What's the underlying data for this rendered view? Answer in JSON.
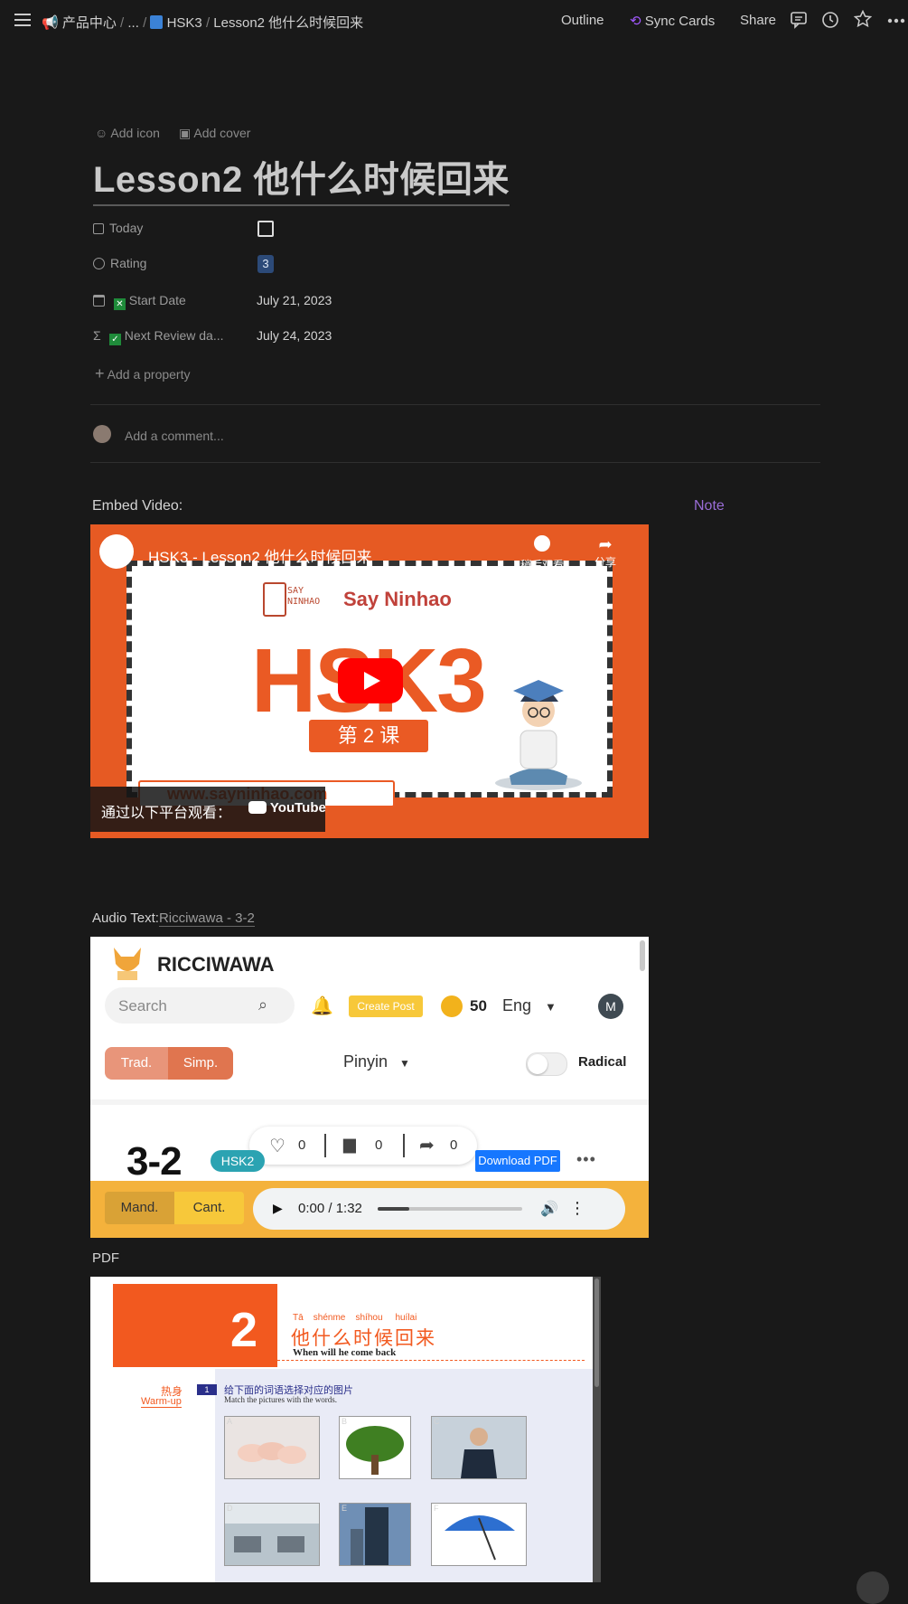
{
  "breadcrumb": {
    "workspace": "产品中心",
    "ellipsis": "...",
    "parent": "HSK3",
    "current": "Lesson2 他什么时候回来"
  },
  "topbar": {
    "outline": "Outline",
    "sync_cards": "Sync Cards",
    "share": "Share"
  },
  "page": {
    "add_icon": "Add icon",
    "add_cover": "Add cover",
    "title": "Lesson2 他什么时候回来"
  },
  "properties": [
    {
      "name": "Today",
      "value": ""
    },
    {
      "name": "Rating",
      "value": "3"
    },
    {
      "name": "Start Date",
      "value": "July 21, 2023"
    },
    {
      "name": "Next Review da...",
      "value": "July 24, 2023"
    }
  ],
  "add_property": "Add a property",
  "comment_placeholder": "Add a comment...",
  "embed_video_label": "Embed Video:",
  "note_label": "Note",
  "video": {
    "title": "HSK3 - Lesson2 他什么时候回来",
    "watch_later": "稍后观看",
    "share": "分享",
    "brand": "Say Ninhao",
    "brand_logo": "SAY NINHAO",
    "big": "HSK3",
    "lesson": "第 2 课",
    "url": "www.sayninhao.com",
    "watch_on": "通过以下平台观看：",
    "youtube": "YouTube"
  },
  "audio_label": "Audio Text:",
  "audio_link": "Ricciwawa - 3-2",
  "ricciwawa": {
    "brand": "RICCIWAWA",
    "search_placeholder": "Search",
    "create_post": "Create Post",
    "coins": "50",
    "lang": "Eng",
    "avatar": "M",
    "trad": "Trad.",
    "simp": "Simp.",
    "pinyin": "Pinyin",
    "radical": "Radical",
    "likes": "0",
    "comments": "0",
    "shares": "0",
    "lesson_no": "3-2",
    "level": "HSK2",
    "download": "Download PDF",
    "mand": "Mand.",
    "cant": "Cant.",
    "time": "0:00 / 1:32",
    "progress": 0.22
  },
  "pdf_label": "PDF",
  "pdf": {
    "num": "2",
    "pinyin": [
      "Tā",
      "shénme",
      "shíhou",
      "huílai"
    ],
    "title_cn": "他什么时候回来",
    "title_en": "When will he come back",
    "warmup_cn": "热身",
    "warmup_en": "Warm-up",
    "ex_no": "1",
    "ex_cn": "给下面的词语选择对应的图片",
    "ex_en": "Match the pictures with the words.",
    "pic_labels": [
      "A",
      "B",
      "C",
      "D",
      "E",
      "F"
    ]
  }
}
